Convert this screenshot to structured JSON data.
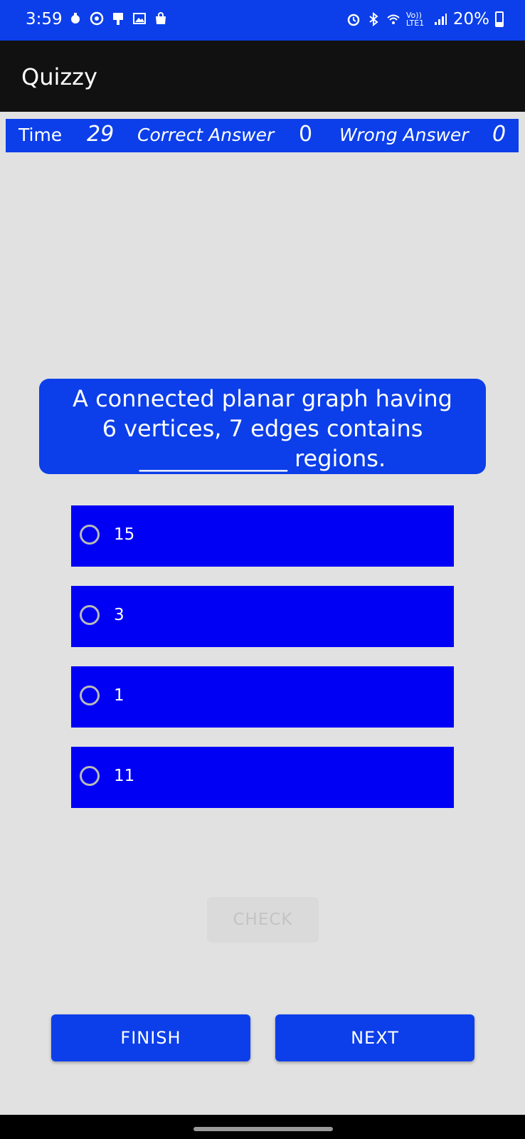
{
  "status_bar": {
    "time": "3:59",
    "battery": "20%",
    "network_label": "Vo)) LTE1",
    "color": "#0c3fe9"
  },
  "app": {
    "title": "Quizzy"
  },
  "scorebar": {
    "time_label": "Time",
    "time_value": "29",
    "correct_label": "Correct Answer",
    "correct_value": "0",
    "wrong_label": "Wrong Answer",
    "wrong_value": "0"
  },
  "question": {
    "line1": "A connected planar graph having",
    "line2": "6 vertices, 7 edges contains",
    "line3": "_____________ regions."
  },
  "options": [
    {
      "label": "15",
      "selected": false
    },
    {
      "label": "3",
      "selected": false
    },
    {
      "label": "1",
      "selected": false
    },
    {
      "label": "11",
      "selected": false
    }
  ],
  "buttons": {
    "check": "CHECK",
    "finish": "FINISH",
    "next": "NEXT"
  },
  "colors": {
    "accent": "#0c3fe9",
    "option_bg": "#0000f5",
    "background": "#e1e1e1",
    "appbar": "#111111"
  }
}
